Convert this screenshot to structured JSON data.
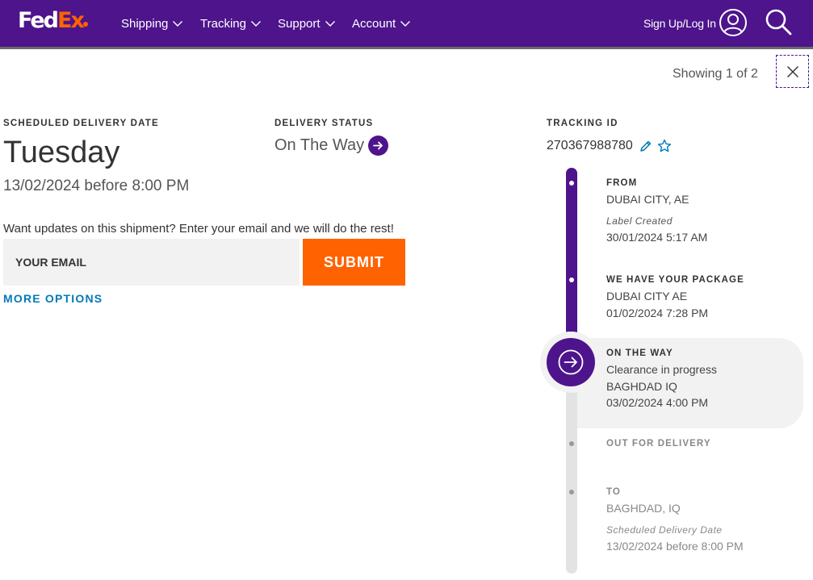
{
  "header": {
    "logo_fed": "Fed",
    "logo_ex": "Ex",
    "nav": [
      {
        "label": "Shipping"
      },
      {
        "label": "Tracking"
      },
      {
        "label": "Support"
      },
      {
        "label": "Account"
      }
    ],
    "signin_label": "Sign Up/Log In"
  },
  "pager": {
    "showing": "Showing 1 of 2"
  },
  "summary": {
    "scheduled_label": "SCHEDULED DELIVERY DATE",
    "day": "Tuesday",
    "date_line": "13/02/2024 before 8:00 PM",
    "status_label": "DELIVERY STATUS",
    "status_value": "On The Way",
    "tracking_label": "TRACKING ID",
    "tracking_id": "270367988780"
  },
  "updates": {
    "prompt": "Want updates on this shipment? Enter your email and we will do the rest!",
    "email_placeholder": "YOUR EMAIL",
    "submit_label": "SUBMIT",
    "more_options": "MORE OPTIONS"
  },
  "timeline": {
    "from": {
      "title": "FROM",
      "location": "DUBAI CITY, AE",
      "note": "Label Created",
      "datetime": "30/01/2024 5:17 AM"
    },
    "have_package": {
      "title": "WE HAVE YOUR PACKAGE",
      "location": "DUBAI CITY AE",
      "datetime": "01/02/2024 7:28 PM"
    },
    "on_the_way": {
      "title": "ON THE WAY",
      "detail": "Clearance in progress",
      "location": "BAGHDAD IQ",
      "datetime": "03/02/2024 4:00 PM"
    },
    "out_for_delivery": {
      "title": "OUT FOR DELIVERY"
    },
    "to": {
      "title": "TO",
      "location": "BAGHDAD, IQ",
      "note": "Scheduled Delivery Date",
      "datetime": "13/02/2024 before 8:00 PM"
    }
  },
  "colors": {
    "brand_purple": "#4d148c",
    "brand_orange": "#ff6200",
    "link_blue": "#007ab7"
  }
}
